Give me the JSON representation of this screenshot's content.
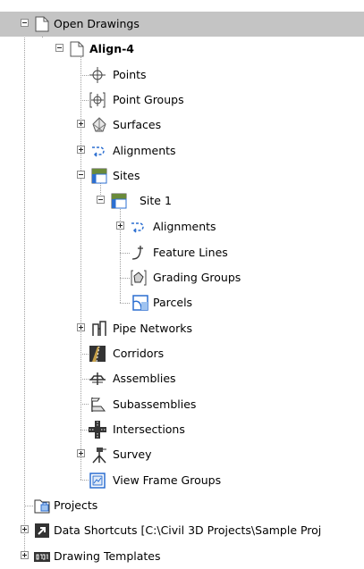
{
  "tree": {
    "open_drawings": "Open Drawings",
    "align4": "Align-4",
    "points": "Points",
    "point_groups": "Point Groups",
    "surfaces": "Surfaces",
    "alignments": "Alignments",
    "sites": "Sites",
    "site1": "Site 1",
    "site_alignments": "Alignments",
    "feature_lines": "Feature Lines",
    "grading_groups": "Grading Groups",
    "parcels": "Parcels",
    "pipe_networks": "Pipe Networks",
    "corridors": "Corridors",
    "assemblies": "Assemblies",
    "subassemblies": "Subassemblies",
    "intersections": "Intersections",
    "survey": "Survey",
    "view_frame_groups": "View Frame Groups",
    "projects": "Projects",
    "data_shortcuts": "Data Shortcuts [C:\\Civil 3D Projects\\Sample Proj",
    "drawing_templates": "Drawing Templates"
  },
  "colors": {
    "selection": "#c4c4c4",
    "connector": "#a0a0a0",
    "accent_blue": "#2c6fd1"
  }
}
